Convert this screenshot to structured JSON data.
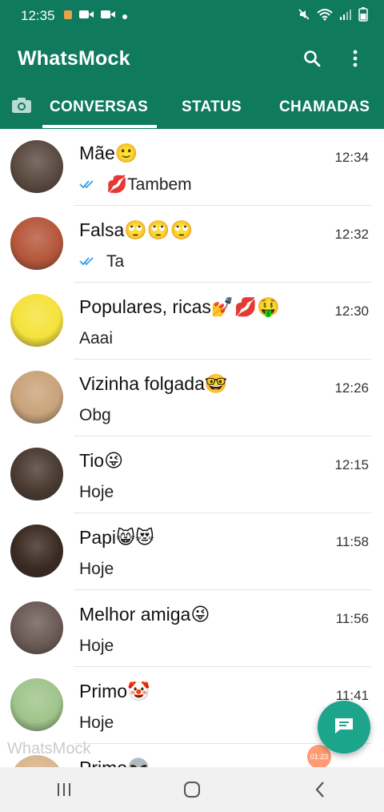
{
  "status_bar": {
    "time": "12:35",
    "icons": [
      "notification-icon",
      "video-icon",
      "video-icon",
      "dot-icon",
      "mute-icon",
      "wifi-icon",
      "signal-icon",
      "battery-icon"
    ]
  },
  "app_bar": {
    "title": "WhatsMock",
    "actions": [
      "search-icon",
      "more-vert-icon"
    ]
  },
  "tabs": [
    {
      "label": "CONVERSAS",
      "active": true
    },
    {
      "label": "STATUS",
      "active": false
    },
    {
      "label": "CHAMADAS",
      "active": false
    }
  ],
  "chats": [
    {
      "name": "Mãe🙂",
      "time": "12:34",
      "ticks": true,
      "preview": "💋Tambem",
      "avatar_color": "#5a4a40"
    },
    {
      "name": "Falsa🙄🙄🙄",
      "time": "12:32",
      "ticks": true,
      "preview": "Ta",
      "avatar_color": "#b5563a"
    },
    {
      "name": "Populares, ricas💅💋🤑",
      "time": "12:30",
      "ticks": false,
      "preview": "Aaai",
      "avatar_color": "#f5e23a"
    },
    {
      "name": "Vizinha folgada🤓",
      "time": "12:26",
      "ticks": false,
      "preview": "Obg",
      "avatar_color": "#c9a37a"
    },
    {
      "name": "Tio😜",
      "time": "12:15",
      "ticks": false,
      "preview": "Hoje",
      "avatar_color": "#4a3a30"
    },
    {
      "name": "Papi😸😻",
      "time": "11:58",
      "ticks": false,
      "preview": "Hoje",
      "avatar_color": "#3a2a22"
    },
    {
      "name": "Melhor amiga😜",
      "time": "11:56",
      "ticks": false,
      "preview": "Hoje",
      "avatar_color": "#6b5a55"
    },
    {
      "name": "Primo🤡",
      "time": "11:41",
      "ticks": false,
      "preview": "Hoje",
      "avatar_color": "#9fc48a"
    },
    {
      "name": "Primo👽",
      "time": "",
      "ticks": false,
      "preview": "",
      "avatar_color": "#d9b58f"
    }
  ],
  "watermark": "WhatsMock",
  "mini_badge": "01:23",
  "colors": {
    "primary": "#0f7a5e",
    "accent": "#1ca58a",
    "tick_blue": "#3b9ee8"
  }
}
